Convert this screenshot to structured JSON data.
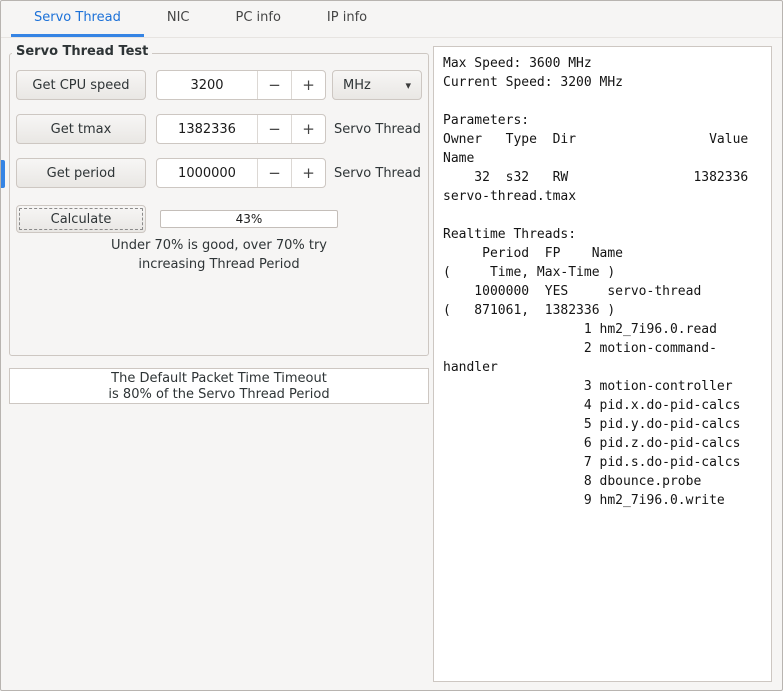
{
  "tabs": [
    {
      "label": "Servo Thread"
    },
    {
      "label": "NIC"
    },
    {
      "label": "PC info"
    },
    {
      "label": "IP info"
    }
  ],
  "icons": {
    "minus": "−",
    "plus": "+",
    "dropdown_arrow": "▾"
  },
  "colors": {
    "accent": "#3584e4",
    "tab_active_text": "#1c71d8"
  },
  "servo_test": {
    "frame_title": "Servo Thread Test",
    "rows": [
      {
        "button": "Get CPU speed",
        "value": "3200",
        "unit": "MHz"
      },
      {
        "button": "Get tmax",
        "value": "1382336",
        "unit": "Servo Thread"
      },
      {
        "button": "Get period",
        "value": "1000000",
        "unit": "Servo Thread"
      }
    ],
    "calculate_label": "Calculate",
    "progress_label": "43%",
    "hint": "Under 70% is good, over 70% try\nincreasing Thread Period"
  },
  "timeout_note": "The Default Packet Time Timeout\nis 80% of the Servo Thread Period",
  "output": {
    "lines": [
      "Max Speed: 3600 MHz",
      "Current Speed: 3200 MHz",
      "",
      "Parameters:",
      "Owner   Type  Dir                 Value",
      "Name",
      "    32  s32   RW                1382336",
      "servo-thread.tmax",
      "",
      "Realtime Threads:",
      "     Period  FP    Name",
      "(     Time, Max-Time )",
      "    1000000  YES     servo-thread",
      "(   871061,  1382336 )",
      "                  1 hm2_7i96.0.read",
      "                  2 motion-command-",
      "handler",
      "                  3 motion-controller",
      "                  4 pid.x.do-pid-calcs",
      "                  5 pid.y.do-pid-calcs",
      "                  6 pid.z.do-pid-calcs",
      "                  7 pid.s.do-pid-calcs",
      "                  8 dbounce.probe",
      "                  9 hm2_7i96.0.write"
    ]
  }
}
